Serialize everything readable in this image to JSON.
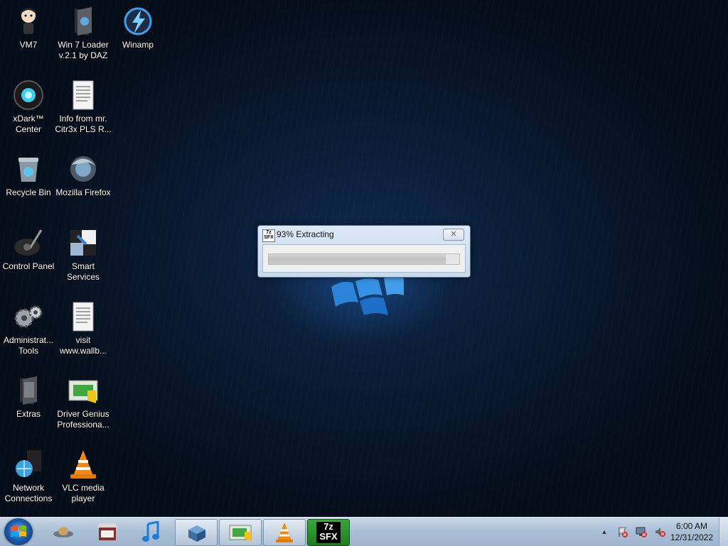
{
  "desktop": {
    "icons": [
      {
        "label": "VM7",
        "icon": "anime-character-icon"
      },
      {
        "label": "Win 7  Loader v.2.1 by DAZ",
        "icon": "folder-icon"
      },
      {
        "label": "Winamp",
        "icon": "winamp-lightning-icon"
      },
      {
        "label": "xDark™ Center",
        "icon": "xdark-orb-icon"
      },
      {
        "label": "Info from mr. Citr3x PLS R...",
        "icon": "text-document-icon"
      },
      {
        "label": "Recycle Bin",
        "icon": "recycle-bin-icon"
      },
      {
        "label": "Mozilla Firefox",
        "icon": "firefox-icon"
      },
      {
        "label": "Control Panel",
        "icon": "control-panel-icon"
      },
      {
        "label": "Smart Services",
        "icon": "smart-services-icon"
      },
      {
        "label": "Administrat... Tools",
        "icon": "admin-tools-gears-icon"
      },
      {
        "label": "visit www.wallb...",
        "icon": "text-document-icon"
      },
      {
        "label": "Extras",
        "icon": "folder-icon"
      },
      {
        "label": "Driver Genius Professiona...",
        "icon": "driver-genius-icon"
      },
      {
        "label": "Network Connections",
        "icon": "network-globe-icon"
      },
      {
        "label": "VLC media player",
        "icon": "vlc-cone-icon"
      }
    ]
  },
  "dialog": {
    "app_icon_top": "7z",
    "app_icon_bottom": "SFX",
    "title": "93% Extracting",
    "close_symbol": "✕",
    "progress_fraction": 0.93
  },
  "taskbar": {
    "start_icon": "windows-start-orb-icon",
    "buttons": [
      {
        "icon": "ufo-icon",
        "state": "pinned"
      },
      {
        "icon": "store-icon",
        "state": "pinned"
      },
      {
        "icon": "music-note-icon",
        "state": "pinned"
      },
      {
        "icon": "installer-box-icon",
        "state": "open"
      },
      {
        "icon": "driver-genius-icon",
        "state": "open"
      },
      {
        "icon": "vlc-cone-icon",
        "state": "open"
      },
      {
        "icon": "7z-sfx-icon",
        "state": "active",
        "text_top": "7z",
        "text_bottom": "SFX"
      }
    ],
    "tray": {
      "overflow_symbol": "▲",
      "time": "6:00 AM",
      "date": "12/31/2022"
    }
  },
  "colors": {
    "desktop_background": "#0a1c34",
    "taskbar": "#a9bfd6",
    "active_task": "#2a962a"
  }
}
